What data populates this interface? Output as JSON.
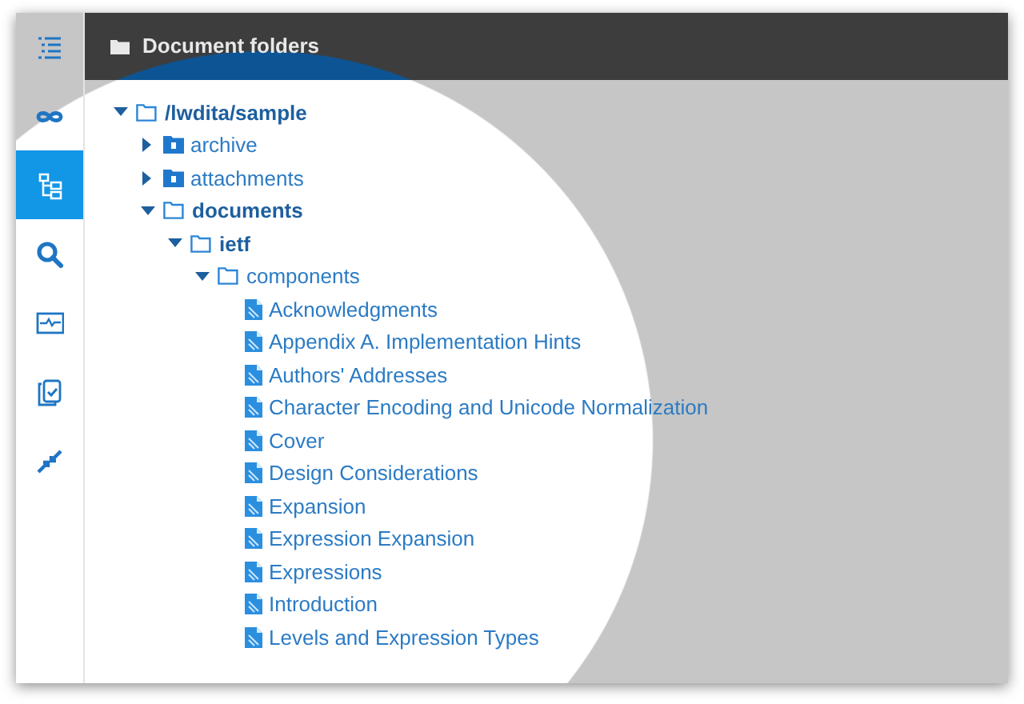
{
  "header": {
    "title": "Document folders"
  },
  "sidebar": {
    "items": [
      {
        "selected": false
      },
      {
        "selected": false
      },
      {
        "selected": true
      },
      {
        "selected": false
      },
      {
        "selected": false
      },
      {
        "selected": false
      },
      {
        "selected": false
      }
    ]
  },
  "tree": [
    {
      "label": "/lwdita/sample",
      "kind": "folder",
      "expanded": true,
      "emphasized": true,
      "children": [
        {
          "label": "archive",
          "kind": "folder",
          "expanded": false,
          "emphasized": false
        },
        {
          "label": "attachments",
          "kind": "folder",
          "expanded": false,
          "emphasized": false
        },
        {
          "label": "documents",
          "kind": "folder",
          "expanded": true,
          "emphasized": true,
          "children": [
            {
              "label": "ietf",
              "kind": "folder",
              "expanded": true,
              "emphasized": true,
              "children": [
                {
                  "label": "components",
                  "kind": "folder",
                  "expanded": true,
                  "emphasized": false,
                  "children": [
                    {
                      "label": "Acknowledgments",
                      "kind": "file"
                    },
                    {
                      "label": "Appendix A. Implementation Hints",
                      "kind": "file"
                    },
                    {
                      "label": "Authors' Addresses",
                      "kind": "file"
                    },
                    {
                      "label": "Character Encoding and Unicode Normalization",
                      "kind": "file"
                    },
                    {
                      "label": "Cover",
                      "kind": "file"
                    },
                    {
                      "label": "Design Considerations",
                      "kind": "file"
                    },
                    {
                      "label": "Expansion",
                      "kind": "file"
                    },
                    {
                      "label": "Expression Expansion",
                      "kind": "file"
                    },
                    {
                      "label": "Expressions",
                      "kind": "file"
                    },
                    {
                      "label": "Introduction",
                      "kind": "file"
                    },
                    {
                      "label": "Levels and Expression Types",
                      "kind": "file"
                    }
                  ]
                }
              ]
            }
          ]
        }
      ]
    }
  ]
}
